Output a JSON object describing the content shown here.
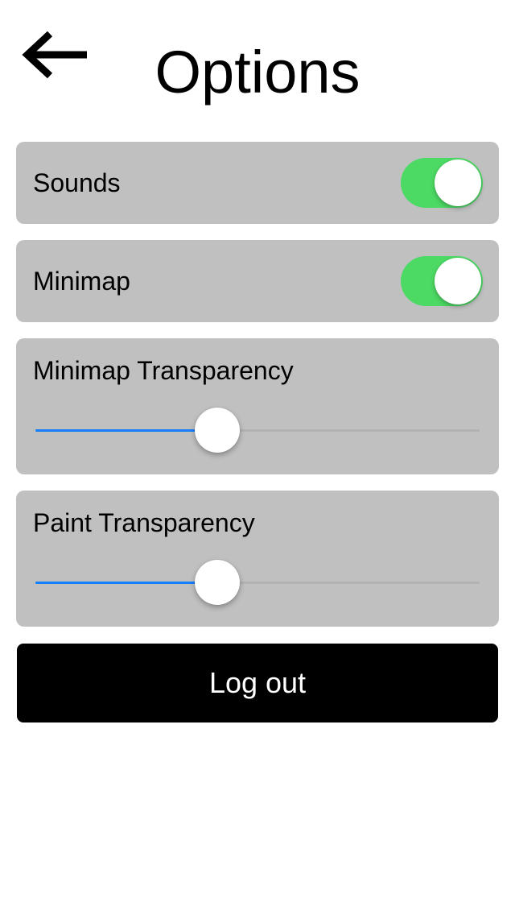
{
  "header": {
    "title": "Options",
    "back_icon": "arrow-left-icon"
  },
  "settings": {
    "sounds": {
      "label": "Sounds",
      "enabled": true
    },
    "minimap": {
      "label": "Minimap",
      "enabled": true
    },
    "minimap_transparency": {
      "label": "Minimap Transparency",
      "value": 0.4
    },
    "paint_transparency": {
      "label": "Paint Transparency",
      "value": 0.4
    }
  },
  "actions": {
    "logout_label": "Log out"
  },
  "colors": {
    "card_background": "#c0c0c0",
    "toggle_on": "#4cd964",
    "slider_fill": "#147efb",
    "logout_background": "#000000",
    "logout_text": "#ffffff"
  }
}
